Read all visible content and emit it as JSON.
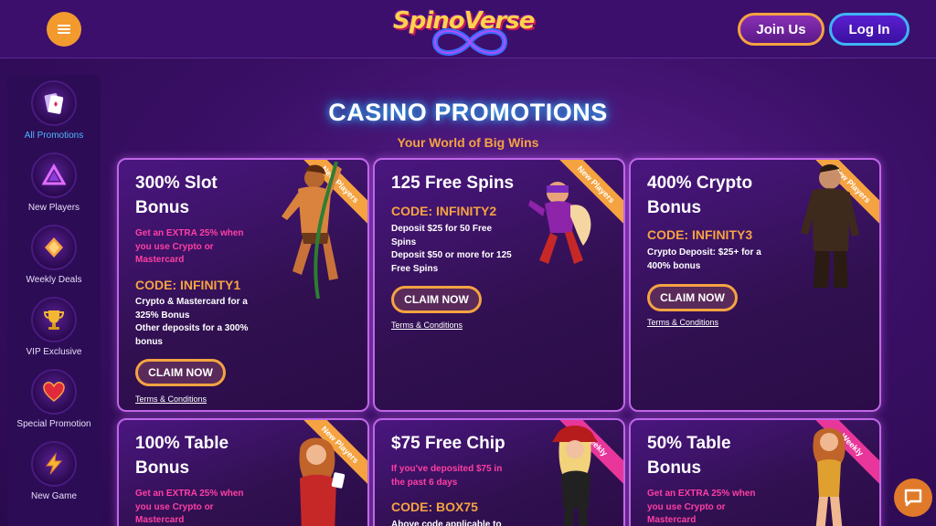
{
  "header": {
    "logo_text": "SpinoVerse",
    "join_label": "Join Us",
    "login_label": "Log In"
  },
  "sidebar": {
    "items": [
      {
        "label": "All Promotions",
        "icon": "cards-icon",
        "active": true
      },
      {
        "label": "New Players",
        "icon": "triangle-icon"
      },
      {
        "label": "Weekly Deals",
        "icon": "diamond-icon"
      },
      {
        "label": "VIP Exclusive",
        "icon": "trophy-icon"
      },
      {
        "label": "Special Promotion",
        "icon": "heart-icon"
      },
      {
        "label": "New Game",
        "icon": "lightning-icon"
      }
    ]
  },
  "page": {
    "title": "CASINO PROMOTIONS",
    "subtitle": "Your World of Big Wins"
  },
  "cards": [
    {
      "title": "300% Slot Bonus",
      "badge": "New Players",
      "note_lines": [
        "Get an EXTRA 25% when",
        "you use Crypto or",
        "Mastercard"
      ],
      "code": "CODE: INFINITY1",
      "desc_lines": [
        "Crypto & Mastercard for a",
        "325% Bonus",
        "Other deposits for a 300%",
        "bonus"
      ],
      "claim": "CLAIM NOW",
      "terms": "Terms & Conditions"
    },
    {
      "title": "125 Free Spins",
      "badge": "New Players",
      "code": "CODE: INFINITY2",
      "desc_lines": [
        "Deposit $25 for 50 Free",
        "Spins",
        "Deposit $50 or more for 125",
        "Free Spins"
      ],
      "claim": "CLAIM NOW",
      "terms": "Terms & Conditions"
    },
    {
      "title": "400% Crypto Bonus",
      "badge": "New Players",
      "code": "CODE: INFINITY3",
      "desc_lines": [
        "Crypto Deposit: $25+ for a",
        "400% bonus"
      ],
      "claim": "CLAIM NOW",
      "terms": "Terms & Conditions"
    },
    {
      "title": "100% Table Bonus",
      "badge": "New Players",
      "note_lines": [
        "Get an EXTRA 25% when",
        "you use Crypto or",
        "Mastercard"
      ]
    },
    {
      "title": "$75 Free Chip",
      "badge": "Weekly",
      "note_lines": [
        "If you've deposited $75 in",
        "the past 6 days"
      ],
      "code": "CODE: BOX75",
      "desc_lines": [
        "Above code applicable to"
      ]
    },
    {
      "title": "50% Table Bonus",
      "badge": "Weekly",
      "note_lines": [
        "Get an EXTRA 25% when",
        "you use Crypto or",
        "Mastercard"
      ]
    }
  ]
}
